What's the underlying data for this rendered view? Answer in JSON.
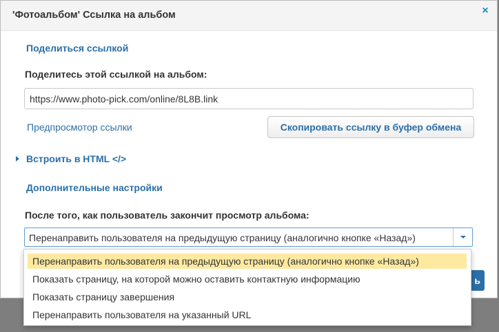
{
  "dialog": {
    "title": "'Фотоальбом' Ссылка на альбом",
    "close_icon": "×"
  },
  "share": {
    "heading": "Поделиться ссылкой",
    "label": "Поделитесь этой ссылкой на альбом:",
    "url_value": "https://www.photo-pick.com/online/8L8B.link",
    "preview_link": "Предпросмотор ссылки",
    "copy_button": "Скопировать ссылку в буфер обмена"
  },
  "embed": {
    "heading": "Встроить в HTML </>"
  },
  "advanced": {
    "heading": "Дополнительные настройки",
    "after_view_label": "После того, как пользователь закончит просмотр альбома:",
    "selected_value": "Перенаправить пользователя на предыдущую страницу (аналогично кнопке «Назад»)",
    "options": [
      "Перенаправить пользователя на предыдущую страницу (аналогично кнопке «Назад»)",
      "Показать страницу, на которой можно оставить контактную информацию",
      "Показать страницу завершения",
      "Перенаправить пользователя на указанный URL"
    ]
  },
  "footer": {
    "partial_button_text": "ь"
  },
  "colors": {
    "link": "#2a6fa8",
    "highlight": "#fde9a0",
    "close": "#1e88c8"
  }
}
